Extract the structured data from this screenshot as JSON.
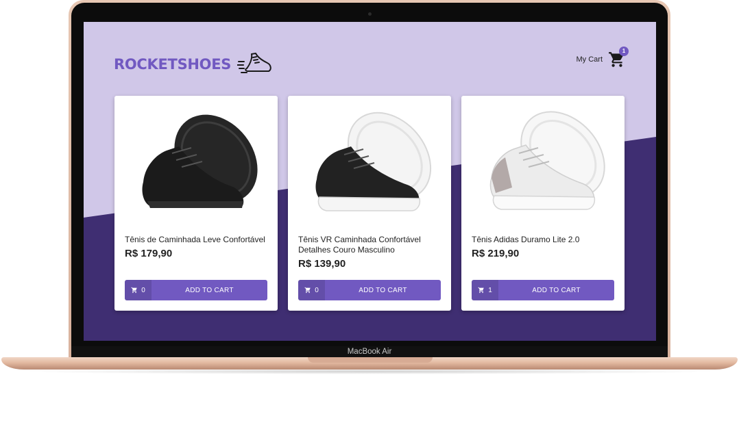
{
  "device": {
    "model": "MacBook Air"
  },
  "header": {
    "logo_text": "ROCKETSHOES",
    "logo_icon": "running-shoe-icon",
    "cart_label": "My Cart",
    "cart_icon": "shopping-cart-icon",
    "cart_count": "1"
  },
  "products": [
    {
      "title": "Tênis de Caminhada Leve Confortável",
      "price": "R$ 179,90",
      "amount": "0",
      "button_label": "ADD TO CART",
      "shoe_style": "black"
    },
    {
      "title": "Tênis VR Caminhada Confortável Detalhes Couro Masculino",
      "price": "R$ 139,90",
      "amount": "0",
      "button_label": "ADD TO CART",
      "shoe_style": "black-white"
    },
    {
      "title": "Tênis Adidas Duramo Lite 2.0",
      "price": "R$ 219,90",
      "amount": "1",
      "button_label": "ADD TO CART",
      "shoe_style": "white"
    }
  ],
  "colors": {
    "brand": "#7159c1",
    "background_light": "#d0c7e8",
    "background_dark": "#3f2e72",
    "laptop_gold": "#e3bba5"
  }
}
